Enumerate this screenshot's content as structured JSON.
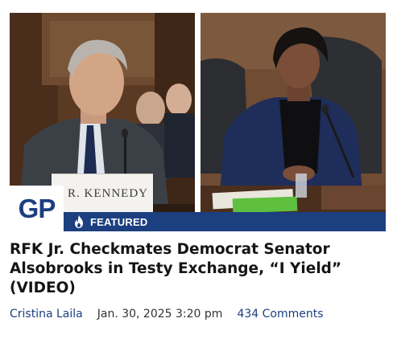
{
  "article": {
    "image": {
      "left_photo": "Man in gray suit at Senate hearing table",
      "right_photo": "Woman in navy blazer speaking at microphone",
      "nameplate_text": "R. KENNEDY"
    },
    "logo": {
      "text": "GP",
      "color": "#1c3f80"
    },
    "badge": {
      "icon": "fire-icon",
      "label": "FEATURED",
      "color": "#1c3f80"
    },
    "headline": "RFK Jr. Checkmates Democrat Senator Alsobrooks in Testy Exchange, “I Yield” (VIDEO)",
    "meta": {
      "author": "Cristina Laila",
      "date": "Jan. 30, 2025 3:20 pm",
      "comments": "434 Comments"
    }
  }
}
